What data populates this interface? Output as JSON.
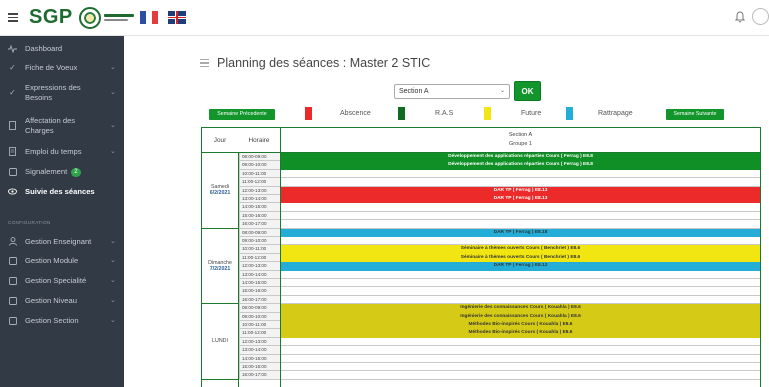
{
  "app": {
    "brand": "SGP",
    "logo_text": "جامعة قسنطينة"
  },
  "sidebar": {
    "items": [
      {
        "label": "Dashboard",
        "icon": "activity-icon"
      },
      {
        "label": "Fiche de Voeux",
        "icon": "check-icon"
      },
      {
        "label": "Expressions des Besoins",
        "icon": "check-icon"
      },
      {
        "label": "Affectation des Charges",
        "icon": "document-icon"
      },
      {
        "label": "Emploi du temps",
        "icon": "document-icon"
      },
      {
        "label": "Signalement",
        "icon": "square-icon",
        "badge": "2"
      },
      {
        "label": "Suivie des séances",
        "icon": "eye-icon"
      },
      {
        "label": "Gestion Enseignant",
        "icon": "person-icon"
      },
      {
        "label": "Gestion Module",
        "icon": "square-icon"
      },
      {
        "label": "Gestion Specialité",
        "icon": "square-icon"
      },
      {
        "label": "Gestion Niveau",
        "icon": "square-icon"
      },
      {
        "label": "Gestion Section",
        "icon": "square-icon"
      }
    ],
    "section_title": "CONFIGURATION"
  },
  "main": {
    "title": "Planning des séances : Master 2 STIC",
    "section_select": {
      "value": "Section A"
    },
    "ok_label": "OK",
    "legend": {
      "prev_label": "Semaine Précedente",
      "next_label": "Semaine Suivante",
      "items": [
        {
          "label": "Abscence",
          "color": "#ec2a2a"
        },
        {
          "label": "R.A.S",
          "color": "#0f6b20"
        },
        {
          "label": "Future",
          "color": "#f1e611"
        },
        {
          "label": "Rattrapage",
          "color": "#24aed7"
        }
      ]
    },
    "table": {
      "col_jour": "Jour",
      "col_horaire": "Horaire",
      "section_header": "Section A",
      "group_header": "Groupe 1",
      "slots": [
        "08:00-09:00",
        "09:00-10:00",
        "10:00-11:00",
        "11:00-12:00",
        "12:00-13:00",
        "13:00-14:00",
        "14:00-15:00",
        "15:00-16:00",
        "16:00-17:00"
      ],
      "days": [
        {
          "name": "Samedi",
          "date": "6/2/2021",
          "sessions": [
            {
              "slot": 0,
              "text": "Développement des applications réparties Cours ( Ferrag ) E8.8",
              "status": "green"
            },
            {
              "slot": 1,
              "text": "Développement des applications réparties Cours ( Ferrag ) E8.8",
              "status": "green"
            },
            {
              "slot": 4,
              "text": "DAR TP ( Ferrag ) E8.13",
              "status": "red"
            },
            {
              "slot": 5,
              "text": "DAR TP ( Ferrag ) E8.13",
              "status": "red"
            }
          ]
        },
        {
          "name": "Dimanche",
          "date": "7/2/2021",
          "sessions": [
            {
              "slot": 0,
              "text": "DAR TP ( Ferrag ) E8.18",
              "status": "cyan"
            },
            {
              "slot": 2,
              "text": "Séminaire à thèmes ouverts Cours ( Benchriet ) E8.6",
              "status": "yellow"
            },
            {
              "slot": 3,
              "text": "Séminaire à thèmes ouverts Cours ( Benchriet ) E8.6",
              "status": "yellow"
            },
            {
              "slot": 4,
              "text": "DAR TP ( Ferrag ) E8.12",
              "status": "cyan"
            }
          ]
        },
        {
          "name": "LUNDI",
          "date": "",
          "sessions": [
            {
              "slot": 0,
              "text": "Ingénierie des connaissances Cours ( Kouahla ) E8.6",
              "status": "olive"
            },
            {
              "slot": 1,
              "text": "Ingénierie des connaissances Cours ( Kouahla ) E8.6",
              "status": "olive"
            },
            {
              "slot": 2,
              "text": "Méthodes Bio-inspirés Cours ( Kouahla ) E8.6",
              "status": "olive"
            },
            {
              "slot": 3,
              "text": "Méthodes Bio-inspirés Cours ( Kouahla ) E8.6",
              "status": "olive"
            }
          ]
        }
      ]
    }
  }
}
